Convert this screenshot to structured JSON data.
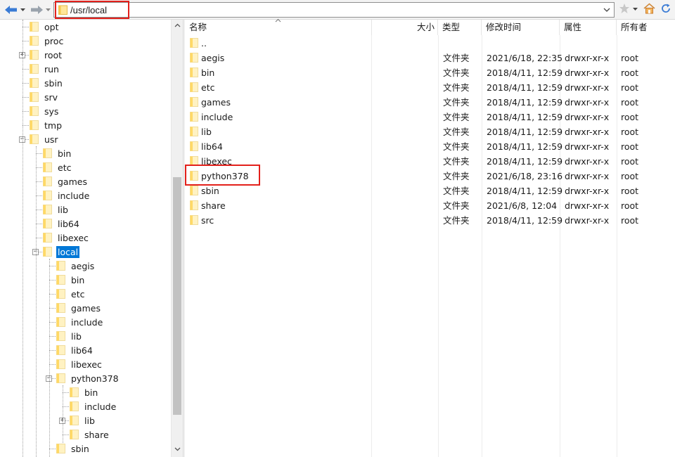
{
  "address_bar": {
    "path": "/usr/local"
  },
  "colors": {
    "folder_fill": "#ffd966",
    "folder_light": "#fff2c2",
    "selection": "#0078d7",
    "highlight_box": "#e3201b"
  },
  "tree": [
    {
      "label": "opt"
    },
    {
      "label": "proc"
    },
    {
      "label": "root"
    },
    {
      "label": "run"
    },
    {
      "label": "sbin"
    },
    {
      "label": "srv"
    },
    {
      "label": "sys"
    },
    {
      "label": "tmp"
    },
    {
      "label": "usr"
    },
    {
      "label": "bin"
    },
    {
      "label": "etc"
    },
    {
      "label": "games"
    },
    {
      "label": "include"
    },
    {
      "label": "lib"
    },
    {
      "label": "lib64"
    },
    {
      "label": "libexec"
    },
    {
      "label": "local"
    },
    {
      "label": "aegis"
    },
    {
      "label": "bin"
    },
    {
      "label": "etc"
    },
    {
      "label": "games"
    },
    {
      "label": "include"
    },
    {
      "label": "lib"
    },
    {
      "label": "lib64"
    },
    {
      "label": "libexec"
    },
    {
      "label": "python378"
    },
    {
      "label": "bin"
    },
    {
      "label": "include"
    },
    {
      "label": "lib"
    },
    {
      "label": "share"
    },
    {
      "label": "sbin"
    }
  ],
  "list": {
    "columns": {
      "name": "名称",
      "size": "大小",
      "type": "类型",
      "modified": "修改时间",
      "attributes": "属性",
      "owner": "所有者"
    },
    "rows": [
      {
        "name": "..",
        "type": "",
        "modified": "",
        "attributes": "",
        "owner": ""
      },
      {
        "name": "aegis",
        "type": "文件夹",
        "modified": "2021/6/18, 22:35",
        "attributes": "drwxr-xr-x",
        "owner": "root"
      },
      {
        "name": "bin",
        "type": "文件夹",
        "modified": "2018/4/11, 12:59",
        "attributes": "drwxr-xr-x",
        "owner": "root"
      },
      {
        "name": "etc",
        "type": "文件夹",
        "modified": "2018/4/11, 12:59",
        "attributes": "drwxr-xr-x",
        "owner": "root"
      },
      {
        "name": "games",
        "type": "文件夹",
        "modified": "2018/4/11, 12:59",
        "attributes": "drwxr-xr-x",
        "owner": "root"
      },
      {
        "name": "include",
        "type": "文件夹",
        "modified": "2018/4/11, 12:59",
        "attributes": "drwxr-xr-x",
        "owner": "root"
      },
      {
        "name": "lib",
        "type": "文件夹",
        "modified": "2018/4/11, 12:59",
        "attributes": "drwxr-xr-x",
        "owner": "root"
      },
      {
        "name": "lib64",
        "type": "文件夹",
        "modified": "2018/4/11, 12:59",
        "attributes": "drwxr-xr-x",
        "owner": "root"
      },
      {
        "name": "libexec",
        "type": "文件夹",
        "modified": "2018/4/11, 12:59",
        "attributes": "drwxr-xr-x",
        "owner": "root"
      },
      {
        "name": "python378",
        "type": "文件夹",
        "modified": "2021/6/18, 23:16",
        "attributes": "drwxr-xr-x",
        "owner": "root"
      },
      {
        "name": "sbin",
        "type": "文件夹",
        "modified": "2018/4/11, 12:59",
        "attributes": "drwxr-xr-x",
        "owner": "root"
      },
      {
        "name": "share",
        "type": "文件夹",
        "modified": "2021/6/8, 12:04",
        "attributes": "drwxr-xr-x",
        "owner": "root"
      },
      {
        "name": "src",
        "type": "文件夹",
        "modified": "2018/4/11, 12:59",
        "attributes": "drwxr-xr-x",
        "owner": "root"
      }
    ]
  }
}
